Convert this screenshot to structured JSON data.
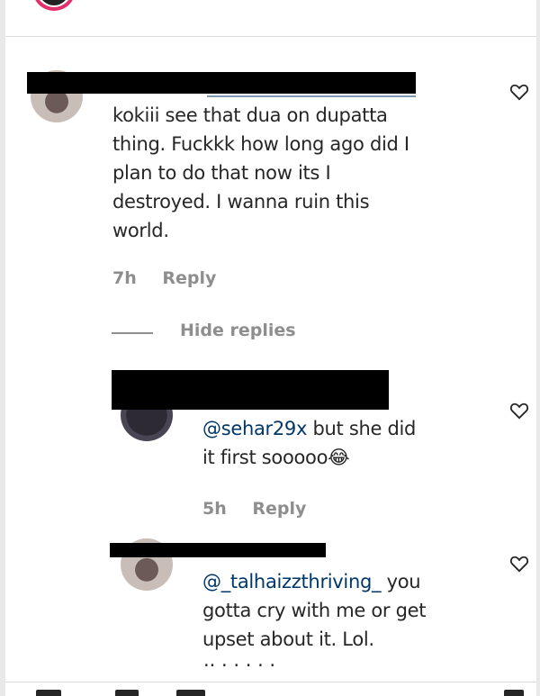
{
  "comments": [
    {
      "text": "kokiii see that dua on dupatta thing. Fuckkk how long ago did I plan to do that now its I destroyed. I wanna ruin this world.",
      "lines": [
        "kokiii see that dua on dupatta",
        "thing. Fuckkk how long ago did I",
        "plan to do that now its I",
        "destroyed. I wanna ruin this",
        "world."
      ],
      "time": "7h",
      "reply_label": "Reply"
    }
  ],
  "hide_replies_label": "Hide replies",
  "replies": [
    {
      "mention": "@sehar29x",
      "text_after_mention": " but she did",
      "second_line": "it first sooooo",
      "emoji": "😂",
      "time": "5h",
      "reply_label": "Reply"
    },
    {
      "mention": "@_talhaizzthriving_",
      "text_after_mention": " you",
      "line2": "gotta cry with me or get",
      "line3": "upset about it. Lol."
    }
  ],
  "icons": [
    "like-heart-icon",
    "like-heart-icon",
    "like-heart-icon",
    "like-heart-icon"
  ],
  "colors": {
    "mention": "#00376b",
    "meta": "#8e8e8e",
    "text": "#262626",
    "redaction": "#000000"
  }
}
